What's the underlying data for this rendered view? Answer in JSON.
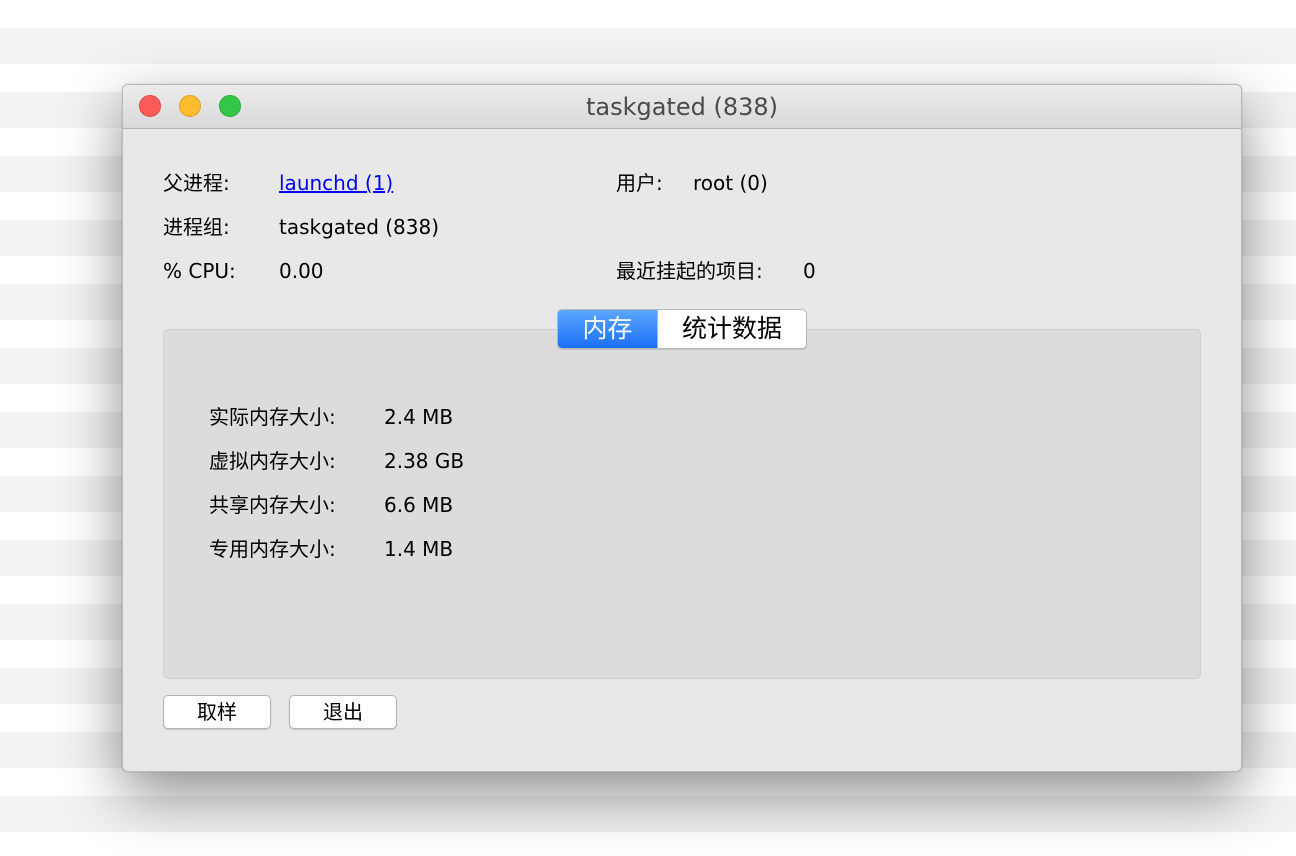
{
  "window": {
    "title": "taskgated (838)"
  },
  "info": {
    "parent_label": "父进程:",
    "parent_value": "launchd (1)",
    "group_label": "进程组:",
    "group_value": "taskgated (838)",
    "cpu_label": "% CPU:",
    "cpu_value": "0.00",
    "user_label": "用户:",
    "user_value": "root (0)",
    "hangs_label": "最近挂起的项目:",
    "hangs_value": "0"
  },
  "tabs": [
    {
      "label": "内存",
      "selected": true
    },
    {
      "label": "统计数据",
      "selected": false
    }
  ],
  "memory": [
    {
      "label": "实际内存大小:",
      "value": "2.4 MB"
    },
    {
      "label": "虚拟内存大小:",
      "value": "2.38 GB"
    },
    {
      "label": "共享内存大小:",
      "value": "6.6 MB"
    },
    {
      "label": "专用内存大小:",
      "value": "1.4 MB"
    }
  ],
  "buttons": {
    "sample": "取样",
    "quit": "退出"
  },
  "colors": {
    "accent": "#1b6ff5",
    "link": "#0000ee",
    "close": "#fc5b57",
    "minimize": "#fdbc2f",
    "zoom": "#33c748"
  }
}
